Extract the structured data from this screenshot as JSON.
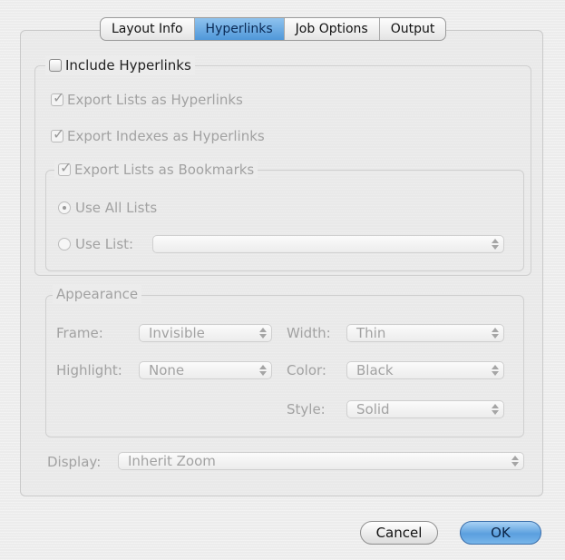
{
  "tabs": [
    {
      "label": "Layout Info",
      "active": false
    },
    {
      "label": "Hyperlinks",
      "active": true
    },
    {
      "label": "Job Options",
      "active": false
    },
    {
      "label": "Output",
      "active": false
    }
  ],
  "include_hyperlinks": {
    "label": "Include Hyperlinks",
    "checked": false
  },
  "export_lists_hyperlinks": {
    "label": "Export Lists as Hyperlinks",
    "checked": true,
    "enabled": false
  },
  "export_indexes_hyperlinks": {
    "label": "Export Indexes as Hyperlinks",
    "checked": true,
    "enabled": false
  },
  "bookmarks": {
    "label": "Export Lists as Bookmarks",
    "checked": true,
    "enabled": false,
    "use_all_lists": {
      "label": "Use All Lists",
      "selected": true
    },
    "use_list": {
      "label": "Use List:",
      "selected": false,
      "value": ""
    }
  },
  "appearance": {
    "legend": "Appearance",
    "frame": {
      "label": "Frame:",
      "value": "Invisible"
    },
    "highlight": {
      "label": "Highlight:",
      "value": "None"
    },
    "width": {
      "label": "Width:",
      "value": "Thin"
    },
    "color": {
      "label": "Color:",
      "value": "Black"
    },
    "style": {
      "label": "Style:",
      "value": "Solid"
    }
  },
  "display": {
    "label": "Display:",
    "value": "Inherit Zoom"
  },
  "buttons": {
    "cancel": "Cancel",
    "ok": "OK"
  },
  "colors": {
    "accent": "#5b9fde",
    "disabled_text": "#a2a2a2"
  }
}
